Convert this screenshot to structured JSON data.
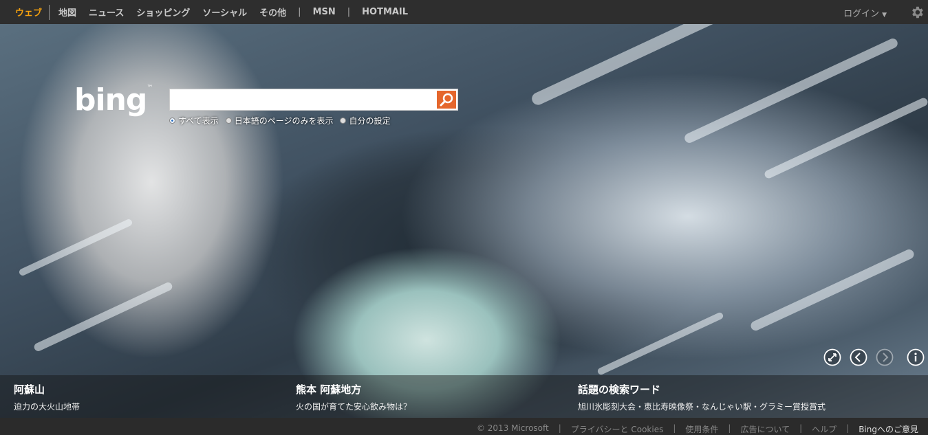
{
  "nav": {
    "items": [
      {
        "label": "ウェブ",
        "active": true
      },
      {
        "label": "地図"
      },
      {
        "label": "ニュース"
      },
      {
        "label": "ショッピング"
      },
      {
        "label": "ソーシャル"
      },
      {
        "label": "その他"
      }
    ],
    "msn": "MSN",
    "hotmail": "HOTMAIL",
    "sep": "|",
    "login": "ログイン"
  },
  "logo": {
    "text": "bing",
    "tm": "™"
  },
  "search": {
    "value": ""
  },
  "options": [
    "すべて表示",
    "日本語のページのみを表示",
    "自分の設定"
  ],
  "stories": [
    {
      "title": "阿蘇山",
      "subtitle": "迫力の大火山地帯"
    },
    {
      "title": "熊本 阿蘇地方",
      "subtitle": "火の国が育てた安心飲み物は？"
    },
    {
      "title": "話題の検索ワード",
      "subtitle": "旭川氷彫刻大会・恵比寿映像祭・なんじゃい駅・グラミー賞授賞式"
    }
  ],
  "footer": [
    "© 2013 Microsoft",
    "プライバシーと Cookies",
    "使用条件",
    "広告について",
    "ヘルプ",
    "Bingへのご意見"
  ],
  "colors": {
    "accent": "#f6a20e",
    "search_button": "#e5662c"
  }
}
